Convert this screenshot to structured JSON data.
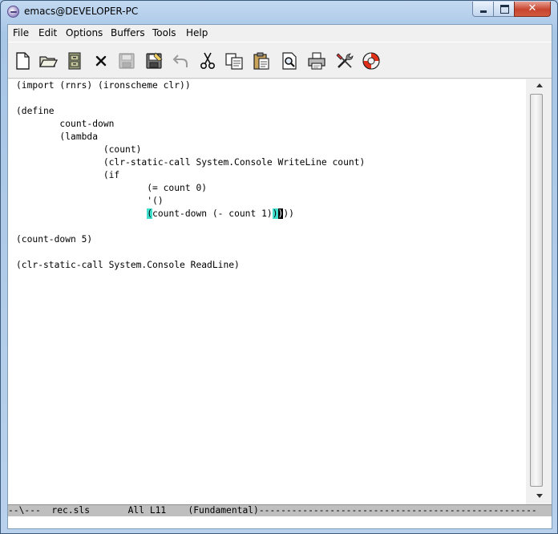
{
  "window": {
    "title": "emacs@DEVELOPER-PC",
    "close_glyph": "✕"
  },
  "menubar": {
    "items": [
      "File",
      "Edit",
      "Options",
      "Buffers",
      "Tools",
      "Help"
    ]
  },
  "toolbar": {
    "buttons": [
      {
        "icon": "new-file-icon",
        "enabled": true
      },
      {
        "icon": "open-folder-icon",
        "enabled": true
      },
      {
        "icon": "dired-cabinet-icon",
        "enabled": true
      },
      {
        "icon": "close-buffer-icon",
        "enabled": true
      },
      {
        "icon": "save-icon",
        "enabled": false
      },
      {
        "icon": "save-as-icon",
        "enabled": true
      },
      {
        "icon": "undo-icon",
        "enabled": false
      },
      {
        "icon": "cut-icon",
        "enabled": true
      },
      {
        "icon": "copy-icon",
        "enabled": true
      },
      {
        "icon": "paste-icon",
        "enabled": true
      },
      {
        "icon": "search-icon",
        "enabled": true
      },
      {
        "icon": "print-icon",
        "enabled": true
      },
      {
        "icon": "preferences-icon",
        "enabled": true
      },
      {
        "icon": "help-lifebuoy-icon",
        "enabled": true
      }
    ]
  },
  "editor": {
    "lines": [
      "(import (rnrs) (ironscheme clr))",
      "",
      "(define",
      "        count-down",
      "        (lambda",
      "                (count)",
      "                (clr-static-call System.Console WriteLine count)",
      "                (if",
      "                        (= count 0)",
      "                        '()",
      "",
      "",
      "(count-down 5)",
      "",
      "(clr-static-call System.Console ReadLine)"
    ],
    "highlight_line": {
      "indent": "                        ",
      "open_paren": "(",
      "middle": "count-down (- count 1)",
      "close_paren": ")",
      "cursor_char": ")",
      "rest": "))"
    },
    "highlight_color": "#40e0d0"
  },
  "modeline": {
    "text": "--\\---  rec.sls       All L11    (Fundamental)---------------------------------------------------"
  },
  "colors": {
    "modeline_bg": "#bfbfbf",
    "title_bar": "#b9d1ec",
    "close_button": "#c7452f"
  }
}
